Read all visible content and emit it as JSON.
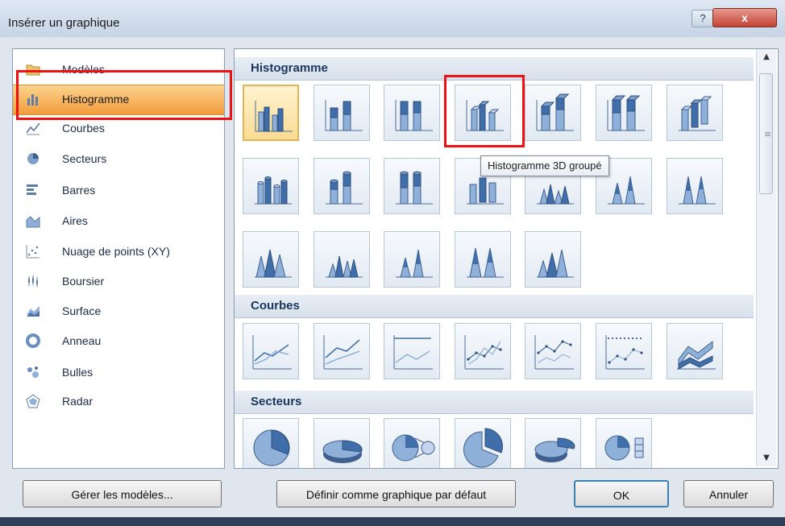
{
  "window": {
    "title": "Insérer un graphique",
    "help_label": "?",
    "close_label": "x"
  },
  "categories": [
    {
      "label": "Modèles",
      "icon": "folder-icon"
    },
    {
      "label": "Histogramme",
      "icon": "column-chart-icon"
    },
    {
      "label": "Courbes",
      "icon": "line-chart-icon"
    },
    {
      "label": "Secteurs",
      "icon": "pie-chart-icon"
    },
    {
      "label": "Barres",
      "icon": "bar-chart-icon"
    },
    {
      "label": "Aires",
      "icon": "area-chart-icon"
    },
    {
      "label": "Nuage de points (XY)",
      "icon": "scatter-chart-icon"
    },
    {
      "label": "Boursier",
      "icon": "stock-chart-icon"
    },
    {
      "label": "Surface",
      "icon": "surface-chart-icon"
    },
    {
      "label": "Anneau",
      "icon": "doughnut-chart-icon"
    },
    {
      "label": "Bulles",
      "icon": "bubble-chart-icon"
    },
    {
      "label": "Radar",
      "icon": "radar-chart-icon"
    }
  ],
  "selected_category": "Histogramme",
  "sections": {
    "histogramme": "Histogramme",
    "courbes": "Courbes",
    "secteurs": "Secteurs"
  },
  "tooltip": "Histogramme 3D groupé",
  "buttons": {
    "manage_templates": "Gérer les modèles...",
    "set_default": "Définir comme graphique par défaut",
    "ok": "OK",
    "cancel": "Annuler"
  },
  "colors": {
    "selection": "#f29c3a",
    "highlight": "#e11111",
    "accent": "#5d7ca6"
  }
}
